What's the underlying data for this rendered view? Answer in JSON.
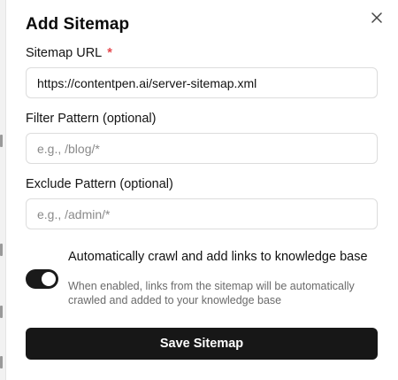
{
  "dialog": {
    "title": "Add Sitemap",
    "close_icon": "close-icon"
  },
  "sitemap_url": {
    "label": "Sitemap URL",
    "required_mark": "*",
    "value": "https://contentpen.ai/server-sitemap.xml"
  },
  "filter_pattern": {
    "label": "Filter Pattern (optional)",
    "placeholder": "e.g., /blog/*"
  },
  "exclude_pattern": {
    "label": "Exclude Pattern (optional)",
    "placeholder": "e.g., /admin/*"
  },
  "auto_crawl": {
    "enabled": true,
    "title": "Automatically crawl and add links to knowledge base",
    "description": "When enabled, links from the sitemap will be automatically crawled and added to your knowledge base"
  },
  "save_button": {
    "label": "Save Sitemap"
  },
  "colors": {
    "primary": "#171717",
    "required": "#e5484d",
    "muted_text": "#6b6b6b",
    "border": "#dcdcdc"
  }
}
